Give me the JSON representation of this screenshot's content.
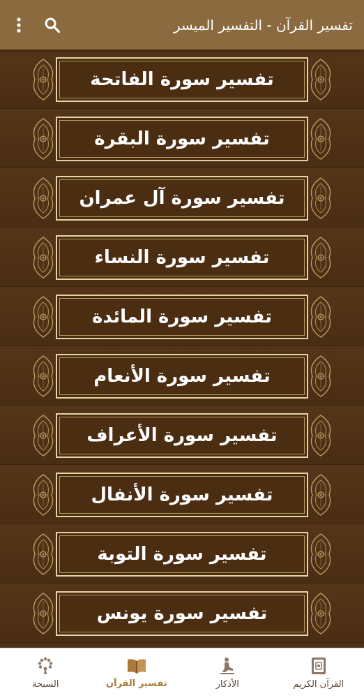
{
  "appbar": {
    "title": "تفسير القرآن - التفسير الميسر",
    "search_icon": "search-icon",
    "menu_icon": "more-vert-icon",
    "background": "#8a6a3e"
  },
  "surahs": [
    {
      "label": "تفسير سورة الفاتحة"
    },
    {
      "label": "تفسير سورة البقرة"
    },
    {
      "label": "تفسير سورة آل عمران"
    },
    {
      "label": "تفسير سورة النساء"
    },
    {
      "label": "تفسير سورة المائدة"
    },
    {
      "label": "تفسير سورة الأنعام"
    },
    {
      "label": "تفسير سورة الأعراف"
    },
    {
      "label": "تفسير سورة الأنفال"
    },
    {
      "label": "تفسير سورة التوبة"
    },
    {
      "label": "تفسير سورة يونس"
    }
  ],
  "bottom_nav": [
    {
      "label": "القرآن الكريم",
      "icon": "quran-book-icon",
      "active": false
    },
    {
      "label": "الأذكار",
      "icon": "praying-person-icon",
      "active": false
    },
    {
      "label": "تفسير القرآن",
      "icon": "open-book-icon",
      "active": true
    },
    {
      "label": "السبحة",
      "icon": "prayer-beads-icon",
      "active": false
    }
  ],
  "colors": {
    "list_background": "#4e3016",
    "card_border": "#e6d3a6",
    "active_nav": "#a97a3c"
  }
}
